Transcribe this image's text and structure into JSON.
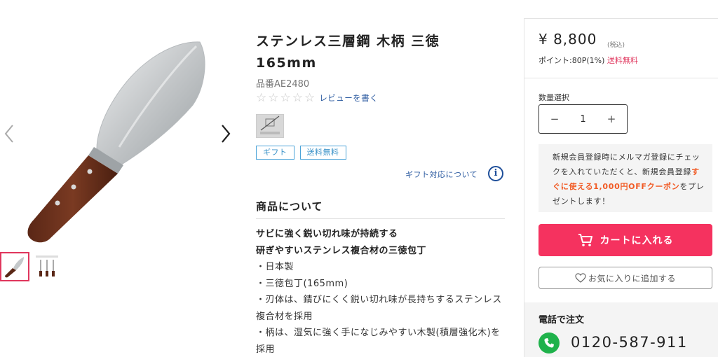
{
  "product": {
    "title": "ステンレス三層鋼 木柄 三徳165mm",
    "sku": "品番AE2480",
    "review_link": "レビューを書く",
    "rating": 0,
    "badges": [
      "ギフト",
      "送料無料"
    ],
    "gift_link": "ギフト対応について",
    "icons": {
      "prev": "chevron-left-icon",
      "next": "chevron-right-icon",
      "dishwasher": "no-dishwasher-icon",
      "info": "info-icon"
    }
  },
  "about": {
    "heading": "商品について",
    "lead": [
      "サビに強く鋭い切れ味が持続する",
      "研ぎやすいステンレス複合材の三徳包丁"
    ],
    "bullets": [
      "・日本製",
      "・三徳包丁(165mm)",
      "・刃体は、錆びにくく鋭い切れ味が長持ちするステンレス複合材を採用",
      "・柄は、湿気に強く手になじみやすい木製(積層強化木)を採用"
    ]
  },
  "purchase": {
    "price": "¥ 8,800",
    "tax": "(税込)",
    "points": "ポイント:80P(1%)",
    "shipping": "送料無料",
    "qty_label": "数量選択",
    "qty_value": "1",
    "minus": "−",
    "plus": "+",
    "promo_before": "新規会員登録時にメルマガ登録にチェックを入れていただくと、新規会員登録",
    "promo_highlight": "すぐに使える1,000円OFFクーポン",
    "promo_after": "をプレゼントします！",
    "cart_button": "カートに入れる",
    "favorite_button": "お気に入りに追加する",
    "phone_label": "電話で注文",
    "phone_number": "0120-587-911",
    "accent_color": "#f5325f",
    "phone_icon_color": "#1fb24b"
  }
}
